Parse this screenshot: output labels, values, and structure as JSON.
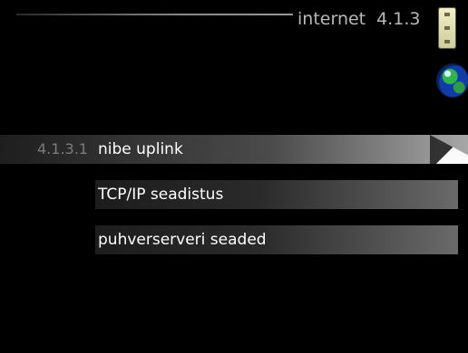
{
  "header": {
    "title": "internet",
    "menu_number": "4.1.3"
  },
  "status_icons": {
    "dial": "thermostat-dial-icon",
    "globe": "globe-icon"
  },
  "menu": {
    "items": [
      {
        "number": "4.1.3.1",
        "label": "nibe uplink",
        "selected": true
      },
      {
        "number": "",
        "label": "TCP/IP seadistus",
        "selected": false
      },
      {
        "number": "",
        "label": "puhverserveri seaded",
        "selected": false
      }
    ]
  }
}
